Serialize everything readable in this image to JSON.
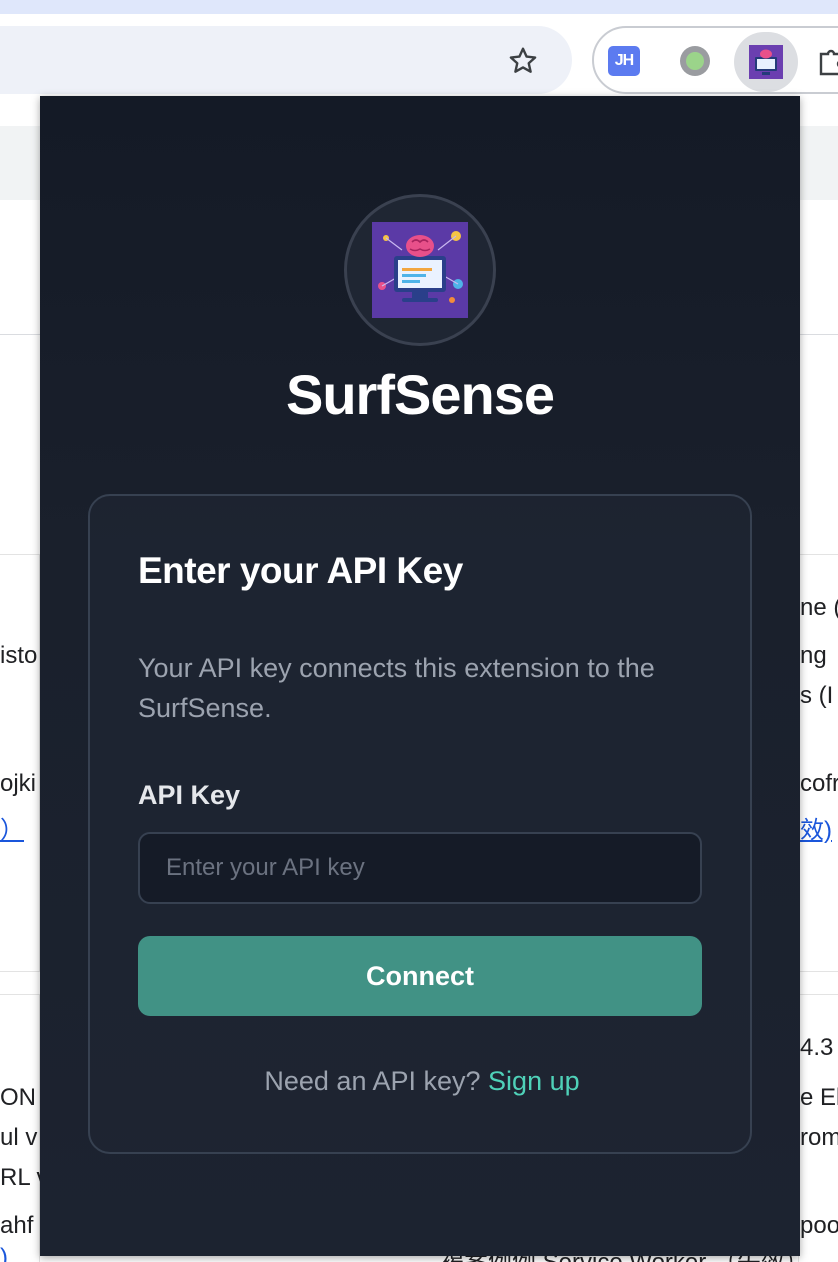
{
  "popup": {
    "app_title": "SurfSense",
    "logo_icon": "brain-computer-icon",
    "card": {
      "heading": "Enter your API Key",
      "description": "Your API key connects this extension to the SurfSense.",
      "field_label": "API Key",
      "input_value": "",
      "input_placeholder": "Enter your API key",
      "button_label": "Connect",
      "signup_prompt": "Need an API key?",
      "signup_link": "Sign up"
    },
    "colors": {
      "background": "#1a202c",
      "button": "#419285",
      "link": "#4fd1b8"
    }
  },
  "browser": {
    "extension_jh_label": "JH",
    "bookmark_icon": "star-icon",
    "extensions_icon": "puzzle-icon"
  },
  "background_page": {
    "left_fragments": [
      "isto",
      "ojki",
      "）",
      "ON",
      "ul v",
      "RL v",
      "ahf",
      ")"
    ],
    "right_fragments": [
      "ne  (",
      "ng",
      "s (I",
      "cofr",
      "效)",
      "4.3",
      "e El",
      "rom",
      "poo"
    ],
    "bottom_fragment": "褐案例例 Service Worker （失效）"
  }
}
